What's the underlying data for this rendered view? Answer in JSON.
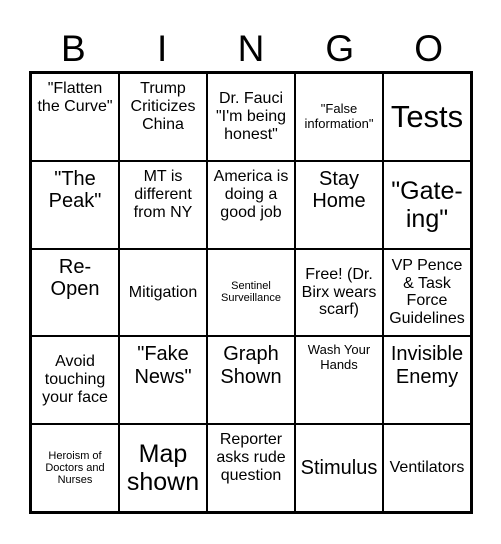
{
  "header": {
    "letters": [
      "B",
      "I",
      "N",
      "G",
      "O"
    ]
  },
  "cells": [
    [
      "\"Flatten the Curve\"",
      "Trump Criticizes China",
      "Dr. Fauci \"I'm being honest\"",
      "\"False information\"",
      "Tests"
    ],
    [
      "\"The Peak\"",
      "MT is different from NY",
      "America is doing a good job",
      "Stay Home",
      "\"Gate-ing\""
    ],
    [
      "Re-Open",
      "Mitigation",
      "Sentinel Surveillance",
      "Free! (Dr. Birx wears scarf)",
      "VP Pence & Task Force Guidelines"
    ],
    [
      "Avoid touching your face",
      "\"Fake News\"",
      "Graph Shown",
      "Wash Your Hands",
      "Invisible Enemy"
    ],
    [
      "Heroism of Doctors and Nurses",
      "Map shown",
      "Reporter asks rude question",
      "Stimulus",
      "Ventilators"
    ]
  ]
}
